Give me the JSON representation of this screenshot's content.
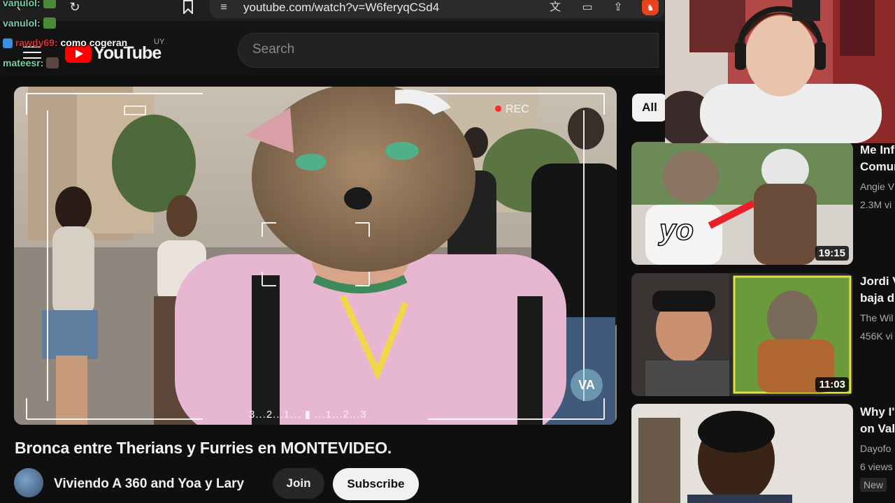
{
  "browser": {
    "url": "youtube.com/watch?v=W6feryqCSd4",
    "back_glyph": "‹",
    "reload_glyph": "↻",
    "bookmark_glyph": "☐",
    "translate_glyph": "文",
    "cast_glyph": "▭",
    "share_glyph": "⇪",
    "brave_glyph": "♞",
    "tune_glyph": "≡"
  },
  "youtube": {
    "logo_text": "YouTube",
    "country_code": "UY",
    "search_placeholder": "Search"
  },
  "chat": [
    {
      "user": "vanulol:",
      "message": ""
    },
    {
      "user": "vanulol:",
      "message": ""
    },
    {
      "user": "rawdy69:",
      "message": "como cogeran"
    },
    {
      "user": "mateesr:",
      "message": ""
    }
  ],
  "video": {
    "rec_label": "REC",
    "countdown": "3...2...1...  ▮  ...1...2...3",
    "watermark": "VA",
    "title": "Bronca entre Therians y Furries en MONTEVIDEO.",
    "channel": "Viviendo A 360 and Yoa y Lary",
    "join_label": "Join",
    "subscribe_label": "Subscribe"
  },
  "sidebar": {
    "chip_all": "All",
    "recommendations": [
      {
        "title": "Me Inf\nComun",
        "channel": "Angie V",
        "views": "2.3M vi",
        "duration": "19:15",
        "thumb_text": "yo"
      },
      {
        "title": "Jordi V\nbaja d",
        "channel": "The Wil",
        "views": "456K vi",
        "duration": "11:03"
      },
      {
        "title": "Why I'\non Val",
        "channel": "Dayofo",
        "views": "6 views",
        "badge": "New"
      }
    ]
  },
  "colors": {
    "youtube_red": "#ff0000",
    "background": "#0f0f0f",
    "chat_name": "#7ad1a8",
    "rec_dot": "#ff2a2a"
  }
}
